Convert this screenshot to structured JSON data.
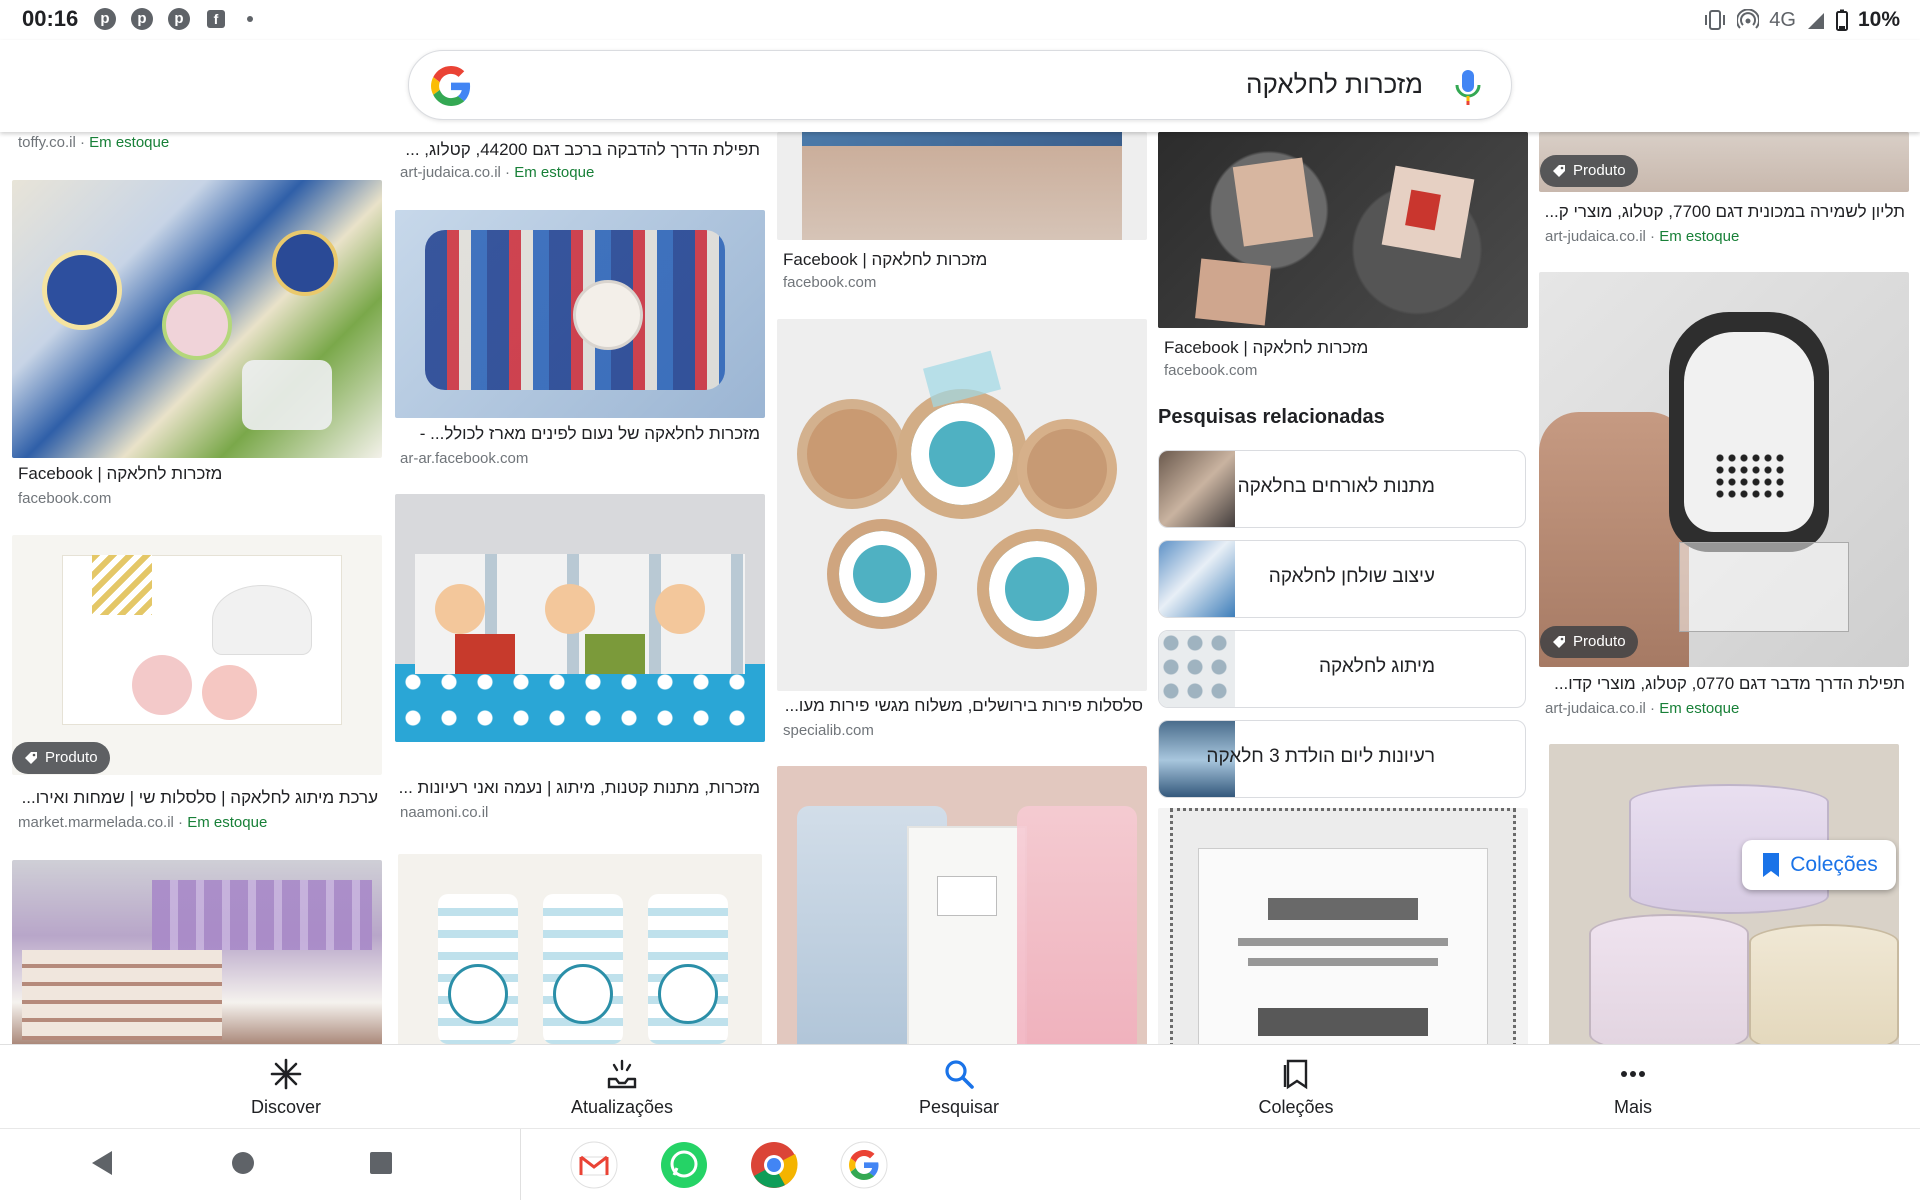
{
  "status_bar": {
    "time": "00:16",
    "notification_icons": [
      "pinterest-icon",
      "pinterest-icon",
      "pinterest-icon",
      "facebook-icon",
      "dot-icon"
    ],
    "network": "4G",
    "battery": "10%"
  },
  "search": {
    "query": "מזכרות לחלאקה",
    "logo": "google-g-logo",
    "mic_icon": "mic-icon"
  },
  "results": {
    "col1": [
      {
        "source": "toffy.co.il",
        "stock": "Em estoque"
      },
      {
        "title": "Facebook | מזכרות לחלאקה",
        "source": "facebook.com"
      },
      {
        "badge": "Produto",
        "title": "ערכת מיתוג לחלאקה | סלסלות שי | שמחות ואירו...",
        "source": "market.marmelada.co.il",
        "stock": "Em estoque"
      }
    ],
    "col2": [
      {
        "title": "תפילת הדרך להדבקה ברכב דגם 44200, קטלוג, ...",
        "source": "art-judaica.co.il",
        "stock": "Em estoque"
      },
      {
        "title": "מזכרות לחלאקה של נעום לפינים מארז לכולל... -",
        "source": "ar-ar.facebook.com"
      },
      {
        "title": "מזכרות, מתנות קטנות, מיתוג | נעמה ואני רעיונות ...",
        "source": "naamoni.co.il"
      }
    ],
    "col3": [
      {
        "title": "Facebook | מזכרות לחלאקה",
        "source": "facebook.com"
      },
      {
        "title": "סלסלות פירות בירושלים, משלוח מגשי פירות מעו...",
        "source": "specialib.com"
      }
    ],
    "col4": [
      {
        "title": "Facebook | מזכרות לחלאקה",
        "source": "facebook.com"
      }
    ],
    "col5": [
      {
        "badge": "Produto",
        "title": "תליון לשמירה במכונית דגם 7700, קטלוג, מוצרי ק...",
        "source": "art-judaica.co.il",
        "stock": "Em estoque"
      },
      {
        "badge": "Produto",
        "title": "תפילת הדרך מדבר דגם 0770, קטלוג, מוצרי קדו...",
        "source": "art-judaica.co.il",
        "stock": "Em estoque"
      }
    ]
  },
  "related": {
    "title": "Pesquisas relacionadas",
    "items": [
      "מתנות לאורחים בחלאקה",
      "עיצוב שולחן לחלאקה",
      "מיתוג לחלאקה",
      "רעיונות ליום הולדת 3 חלאקה"
    ]
  },
  "collections_button": "Coleções",
  "bottom_nav": [
    {
      "label": "Discover",
      "icon": "asterisk-icon"
    },
    {
      "label": "Atualizações",
      "icon": "updates-icon"
    },
    {
      "label": "Pesquisar",
      "icon": "search-icon"
    },
    {
      "label": "Coleções",
      "icon": "bookmark-icon"
    },
    {
      "label": "Mais",
      "icon": "more-icon"
    }
  ],
  "dock": [
    "gmail-icon",
    "whatsapp-icon",
    "chrome-icon",
    "google-icon"
  ],
  "colors": {
    "accent": "#1a73e8",
    "stock": "#188038"
  }
}
